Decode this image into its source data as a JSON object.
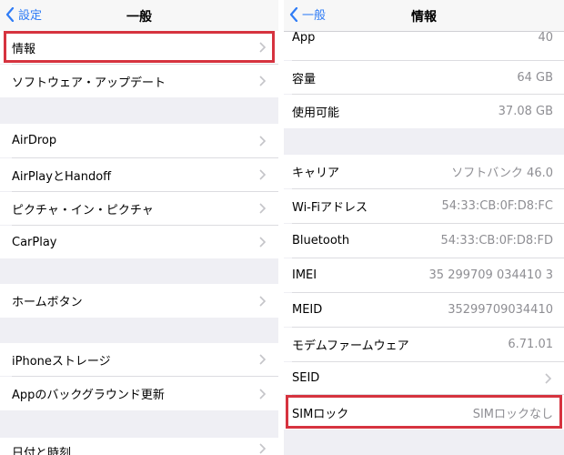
{
  "left": {
    "back_label": "設定",
    "title": "一般",
    "items": [
      {
        "label": "情報"
      },
      {
        "label": "ソフトウェア・アップデート"
      },
      {
        "label": "AirDrop"
      },
      {
        "label": "AirPlayとHandoff"
      },
      {
        "label": "ピクチャ・イン・ピクチャ"
      },
      {
        "label": "CarPlay"
      },
      {
        "label": "ホームボタン"
      },
      {
        "label": "iPhoneストレージ"
      },
      {
        "label": "Appのバックグラウンド更新"
      },
      {
        "label": "日付と時刻"
      }
    ]
  },
  "right": {
    "back_label": "一般",
    "title": "情報",
    "items": [
      {
        "label": "App",
        "value": "40"
      },
      {
        "label": "容量",
        "value": "64 GB"
      },
      {
        "label": "使用可能",
        "value": "37.08 GB"
      },
      {
        "label": "キャリア",
        "value": "ソフトバンク 46.0"
      },
      {
        "label": "Wi-Fiアドレス",
        "value": "54:33:CB:0F:D8:FC"
      },
      {
        "label": "Bluetooth",
        "value": "54:33:CB:0F:D8:FD"
      },
      {
        "label": "IMEI",
        "value": "35 299709 034410 3"
      },
      {
        "label": "MEID",
        "value": "35299709034410"
      },
      {
        "label": "モデムファームウェア",
        "value": "6.71.01"
      },
      {
        "label": "SEID",
        "value": ""
      },
      {
        "label": "SIMロック",
        "value": "SIMロックなし"
      }
    ]
  },
  "colors": {
    "accent": "#2f7cf6",
    "highlight": "#d6333f",
    "background": "#efeff4"
  }
}
